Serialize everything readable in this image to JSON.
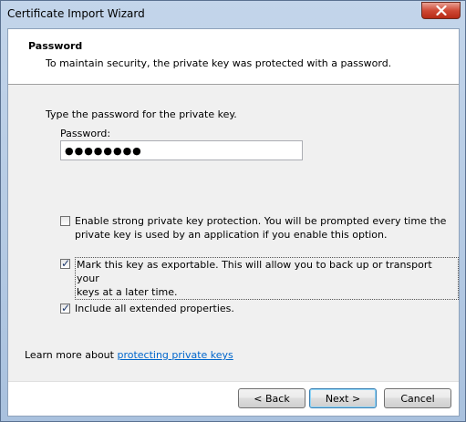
{
  "window": {
    "title": "Certificate Import Wizard"
  },
  "header": {
    "title": "Password",
    "description": "To maintain security, the private key was protected with a password."
  },
  "body": {
    "prompt": "Type the password for the private key.",
    "password_label": "Password:",
    "password_value": "●●●●●●●●",
    "options": [
      {
        "label_line1": "Enable strong private key protection. You will be prompted every time the",
        "label_line2": "private key is used by an application if you enable this option.",
        "checked": false
      },
      {
        "label_line1": "Mark this key as exportable. This will allow you to back up or transport your",
        "label_line2": "keys at a later time.",
        "checked": true
      },
      {
        "label_line1": "Include all extended properties.",
        "checked": true
      }
    ],
    "learn_more_prefix": "Learn more about ",
    "learn_more_link": "protecting private keys"
  },
  "footer": {
    "back_label": "< Back",
    "next_label": "Next >",
    "cancel_label": "Cancel"
  },
  "icons": {
    "close": "close-icon",
    "check": "checkmark-icon"
  },
  "colors": {
    "link": "#0066cc",
    "close_button": "#cf4a36"
  }
}
